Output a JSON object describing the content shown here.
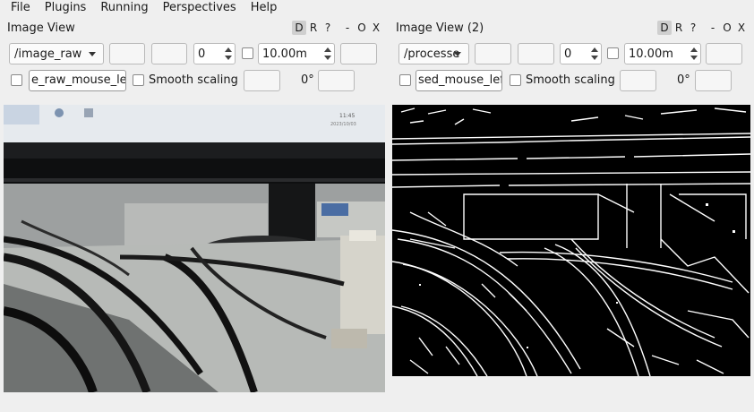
{
  "menu": [
    "File",
    "Plugins",
    "Running",
    "Perspectives",
    "Help"
  ],
  "left_pane": {
    "title": "Image View",
    "title_buttons": [
      "D",
      "R",
      "?",
      "-",
      "O",
      "X"
    ],
    "topic": "/image_raw",
    "spin_value": "0",
    "max_range": "10.00m",
    "mouse_topic": "e_raw_mouse_left",
    "smooth_label": "Smooth scaling",
    "rotation": "0°",
    "screen_clock": "11:45",
    "screen_date": "2023/10/03"
  },
  "right_pane": {
    "title": "Image View (2)",
    "title_buttons": [
      "D",
      "R",
      "?",
      "-",
      "O",
      "X"
    ],
    "topic": "/processe",
    "spin_value": "0",
    "max_range": "10.00m",
    "mouse_topic": "sed_mouse_left",
    "smooth_label": "Smooth scaling",
    "rotation": "0°"
  },
  "colors": {
    "background": "#efefef",
    "edge_image_bg": "#000000",
    "edge_lines": "#ffffff"
  }
}
